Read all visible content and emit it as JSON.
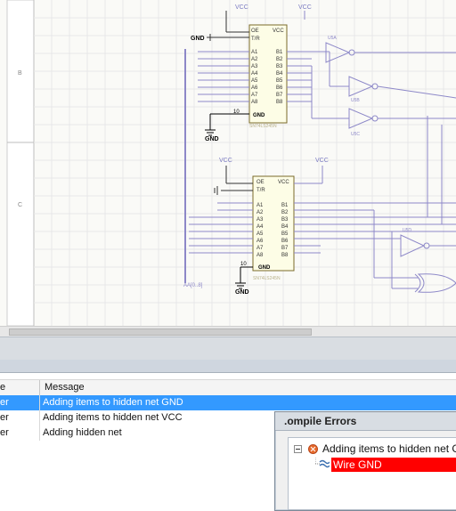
{
  "schematic": {
    "rows": [
      "B",
      "C"
    ],
    "top_vcc_labels": [
      "VCC",
      "VCC"
    ],
    "mid_vcc_labels": [
      "VCC",
      "VCC"
    ],
    "gnd_labels": [
      "GND",
      "GND",
      "GND",
      "GND"
    ],
    "chip1": {
      "name": "SN74LS245N",
      "pins_left": [
        "OE",
        "T/R",
        "A1",
        "A2",
        "A3",
        "A4",
        "A5",
        "A6",
        "A7",
        "A8"
      ],
      "pins_right": [
        "VCC",
        "B1",
        "B2",
        "B3",
        "B4",
        "B5",
        "B6",
        "B7",
        "B8"
      ],
      "gnd_pin": "GND",
      "pin_no": "10"
    },
    "chip2": {
      "name": "SN74LS245N",
      "pins_left": [
        "OE",
        "T/R",
        "A1",
        "A2",
        "A3",
        "A4",
        "A5",
        "A6",
        "A7",
        "A8"
      ],
      "pins_right": [
        "VCC",
        "B1",
        "B2",
        "B3",
        "B4",
        "B5",
        "B6",
        "B7",
        "B8"
      ],
      "gnd_pin": "GND",
      "pin_no": "10"
    },
    "inverters": [
      "U5A",
      "U5B",
      "U5C",
      "U5D"
    ],
    "bus_label": "AA[0..8]"
  },
  "messages": {
    "columns": [
      "e",
      "Message"
    ],
    "rows": [
      {
        "class": "er",
        "message": "Adding items to hidden net GND"
      },
      {
        "class": "er",
        "message": "Adding items to hidden net VCC"
      },
      {
        "class": "er",
        "message": "Adding hidden net"
      }
    ]
  },
  "compile_dialog": {
    "title": ".ompile Errors",
    "node": "Adding items to hidden net GND",
    "child": "Wire GND"
  },
  "colors": {
    "wire": "#8d88c8",
    "selection": "#3399ff",
    "error_highlight": "#ff0000"
  }
}
